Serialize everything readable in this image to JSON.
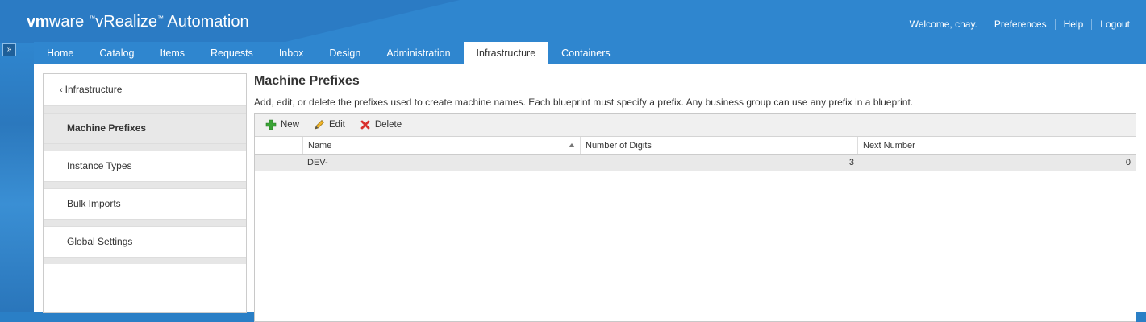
{
  "header": {
    "brand_vm": "vm",
    "brand_ware": "ware",
    "brand_tm": "™",
    "product": "vRealize",
    "product_tm": "™",
    "product_suffix": " Automation",
    "welcome": "Welcome, chay.",
    "preferences": "Preferences",
    "help": "Help",
    "logout": "Logout"
  },
  "collapse_icon": "»",
  "nav": {
    "tabs": [
      {
        "label": "Home"
      },
      {
        "label": "Catalog"
      },
      {
        "label": "Items"
      },
      {
        "label": "Requests"
      },
      {
        "label": "Inbox"
      },
      {
        "label": "Design"
      },
      {
        "label": "Administration"
      },
      {
        "label": "Infrastructure",
        "active": true
      },
      {
        "label": "Containers"
      }
    ]
  },
  "sidebar": {
    "back_label": "Infrastructure",
    "items": [
      {
        "label": "Machine Prefixes",
        "active": true
      },
      {
        "label": "Instance Types"
      },
      {
        "label": "Bulk Imports"
      },
      {
        "label": "Global Settings"
      }
    ]
  },
  "main": {
    "title": "Machine Prefixes",
    "description": "Add, edit, or delete the prefixes used to create machine names. Each blueprint must specify a prefix. Any business group can use any prefix in a blueprint.",
    "toolbar": {
      "new_label": "New",
      "edit_label": "Edit",
      "delete_label": "Delete"
    },
    "table": {
      "columns": [
        "Name",
        "Number of Digits",
        "Next Number"
      ],
      "rows": [
        {
          "name": "DEV-",
          "digits": "3",
          "next": "0"
        }
      ]
    }
  },
  "colors": {
    "header_blue": "#2f86cf",
    "new_icon_green": "#3aa335",
    "delete_icon_red": "#d9302c"
  }
}
